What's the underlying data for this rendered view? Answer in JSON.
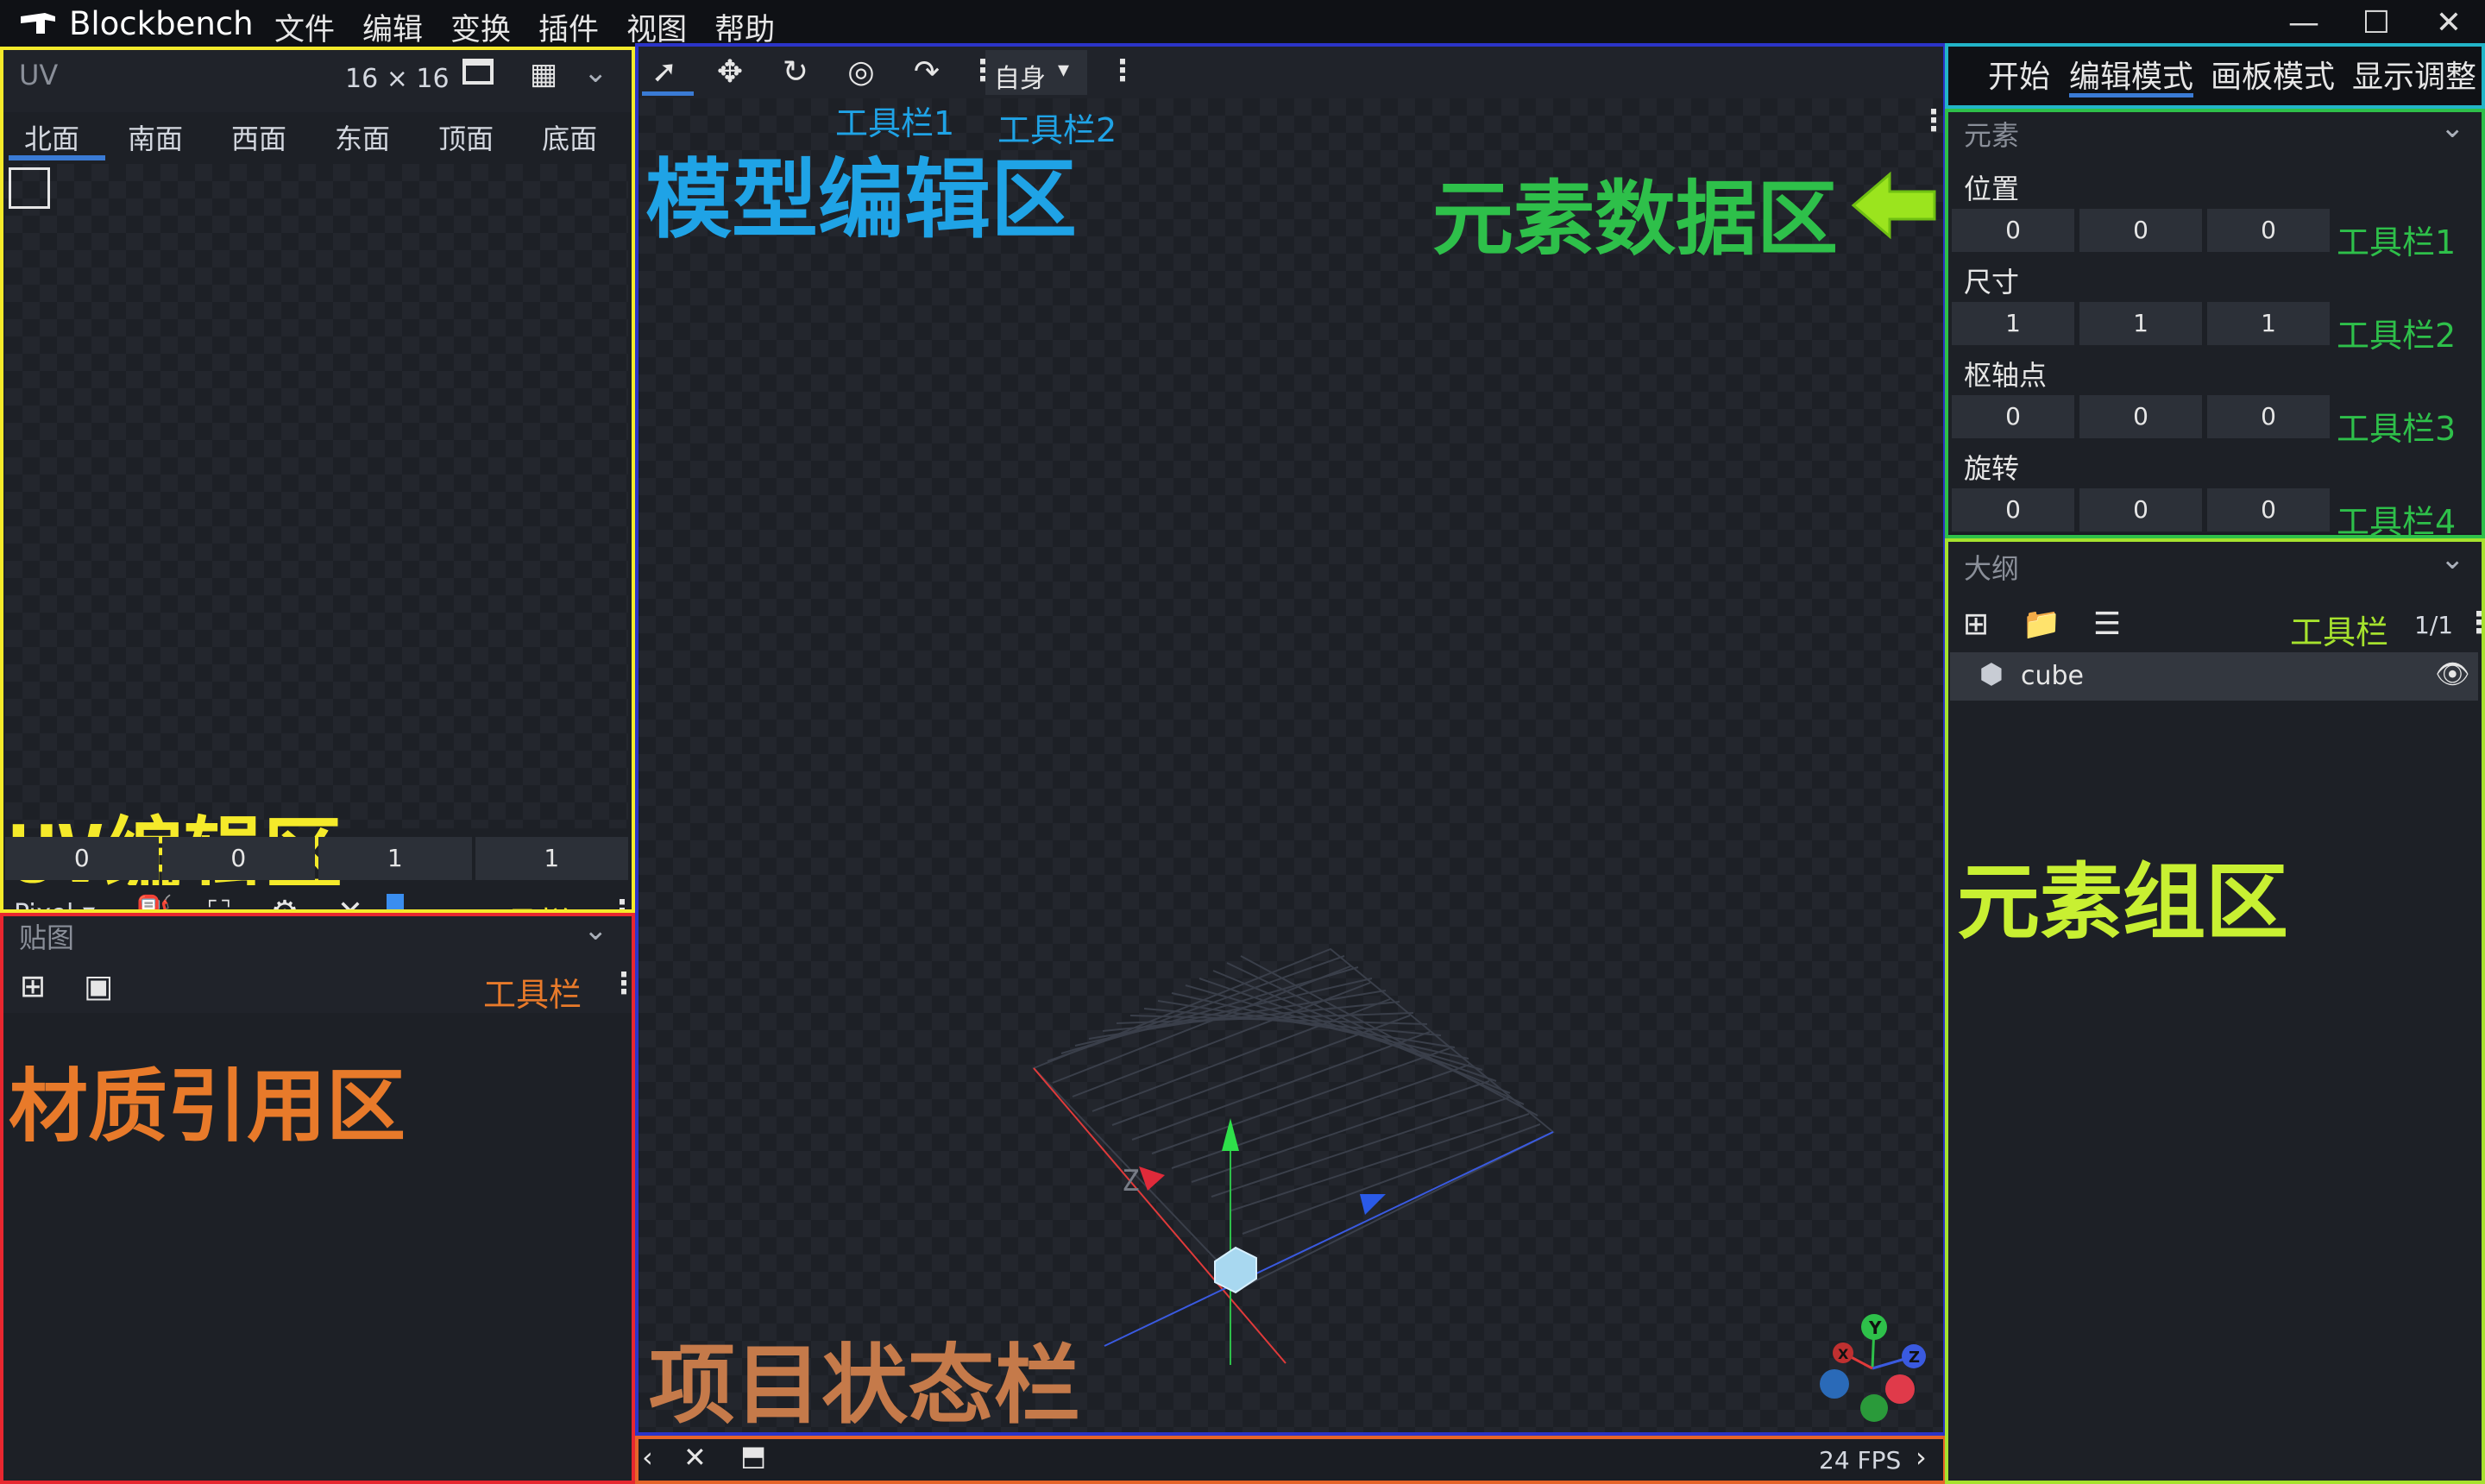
{
  "app": {
    "name": "Blockbench"
  },
  "menu": [
    "文件",
    "编辑",
    "变换",
    "插件",
    "视图",
    "帮助"
  ],
  "window_controls": {
    "minimize": "—",
    "maximize": "☐",
    "close": "✕"
  },
  "uv_panel": {
    "title": "UV",
    "size": "16 × 16",
    "faces": [
      "北面",
      "南面",
      "西面",
      "东面",
      "顶面",
      "底面"
    ],
    "active_face": "北面",
    "values": [
      "0",
      "0",
      "1",
      "1"
    ],
    "mode": "Pixel",
    "toolbar_label": "工具栏",
    "annotation": "UV编辑区"
  },
  "texture_panel": {
    "title": "贴图",
    "toolbar_label": "工具栏",
    "annotation": "材质引用区"
  },
  "viewport": {
    "space_select": "自身",
    "toolbar1_label": "工具栏1",
    "toolbar2_label": "工具栏2",
    "annotation_model": "模型编辑区",
    "annotation_element_data": "元素数据区",
    "annotation_status": "项目状态栏",
    "fps": "24 FPS",
    "gizmo": {
      "x": "X",
      "y": "Y",
      "z": "Z"
    },
    "axis_label": "Z"
  },
  "mode_tabs": [
    "开始",
    "编辑模式",
    "画板模式",
    "显示调整"
  ],
  "active_mode": "编辑模式",
  "element_panel": {
    "title": "元素",
    "rows": [
      {
        "label": "位置",
        "values": [
          "0",
          "0",
          "0"
        ],
        "toolbar": "工具栏1"
      },
      {
        "label": "尺寸",
        "values": [
          "1",
          "1",
          "1"
        ],
        "toolbar": "工具栏2"
      },
      {
        "label": "枢轴点",
        "values": [
          "0",
          "0",
          "0"
        ],
        "toolbar": "工具栏3"
      },
      {
        "label": "旋转",
        "values": [
          "0",
          "0",
          "0"
        ],
        "toolbar": "工具栏4"
      }
    ]
  },
  "outliner": {
    "title": "大纲",
    "toolbar_label": "工具栏",
    "page": "1/1",
    "items": [
      {
        "name": "cube"
      }
    ],
    "annotation": "元素组区"
  },
  "colors": {
    "uv_zone": "#f5ea2a",
    "texture_zone": "#e8272f",
    "viewport_zone": "#2b34c9",
    "status_zone": "#e6642a",
    "modes_zone": "#22b5c8",
    "element_zone": "#2ec04a",
    "outliner_zone": "#a6e22e",
    "annotation_blue": "#1fa3e6",
    "annotation_green": "#2ec04a",
    "annotation_orange": "#e87a2a",
    "annotation_lime": "#c8f032",
    "annotation_status": "#c57a4a"
  }
}
